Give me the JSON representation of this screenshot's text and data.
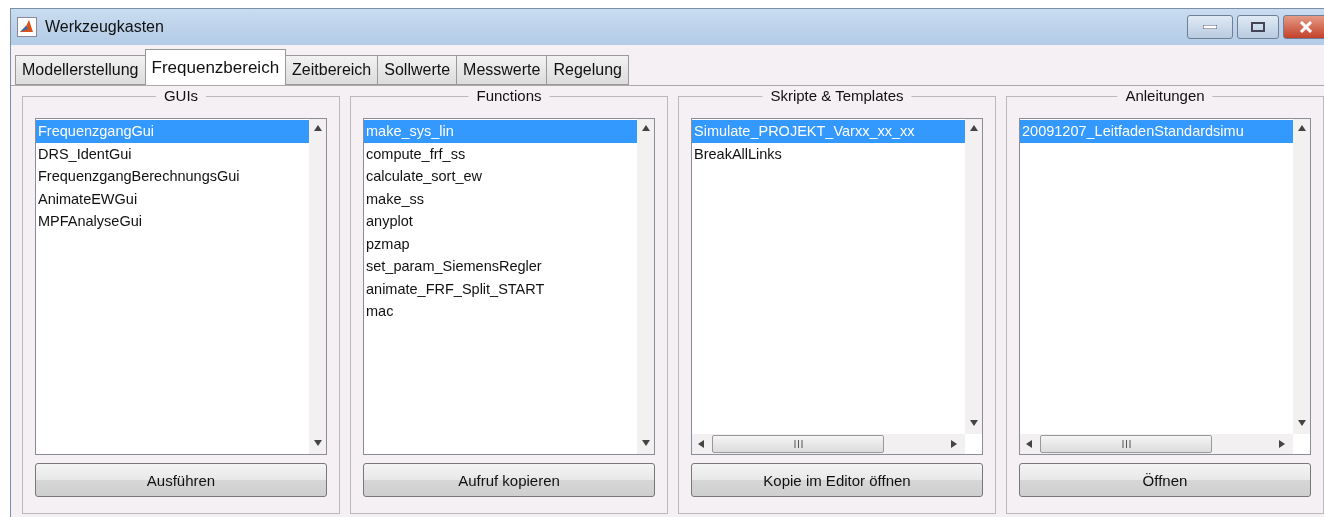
{
  "window": {
    "title": "Werkzeugkasten"
  },
  "tabs": [
    {
      "label": "Modellerstellung",
      "selected": false
    },
    {
      "label": "Frequenzbereich",
      "selected": true
    },
    {
      "label": "Zeitbereich",
      "selected": false
    },
    {
      "label": "Sollwerte",
      "selected": false
    },
    {
      "label": "Messwerte",
      "selected": false
    },
    {
      "label": "Regelung",
      "selected": false
    }
  ],
  "panels": [
    {
      "title": "GUIs",
      "horizontal_scrollbar": false,
      "button": "Ausführen",
      "items": [
        {
          "label": "FrequenzgangGui",
          "selected": true
        },
        {
          "label": "DRS_IdentGui",
          "selected": false
        },
        {
          "label": "FrequenzgangBerechnungsGui",
          "selected": false
        },
        {
          "label": "AnimateEWGui",
          "selected": false
        },
        {
          "label": "MPFAnalyseGui",
          "selected": false
        }
      ]
    },
    {
      "title": "Functions",
      "horizontal_scrollbar": false,
      "button": "Aufruf kopieren",
      "items": [
        {
          "label": "make_sys_lin",
          "selected": true
        },
        {
          "label": "compute_frf_ss",
          "selected": false
        },
        {
          "label": "calculate_sort_ew",
          "selected": false
        },
        {
          "label": "make_ss",
          "selected": false
        },
        {
          "label": "anyplot",
          "selected": false
        },
        {
          "label": "pzmap",
          "selected": false
        },
        {
          "label": "set_param_SiemensRegler",
          "selected": false
        },
        {
          "label": "animate_FRF_Split_START",
          "selected": false
        },
        {
          "label": "mac",
          "selected": false
        }
      ]
    },
    {
      "title": "Skripte & Templates",
      "horizontal_scrollbar": true,
      "button": "Kopie im Editor öffnen",
      "items": [
        {
          "label": "Simulate_PROJEKT_Varxx_xx_xx",
          "selected": true
        },
        {
          "label": "BreakAllLinks",
          "selected": false
        }
      ]
    },
    {
      "title": "Anleitungen",
      "horizontal_scrollbar": true,
      "button": "Öffnen",
      "items": [
        {
          "label": "20091207_LeitfadenStandardsimu",
          "selected": true
        }
      ]
    }
  ]
}
